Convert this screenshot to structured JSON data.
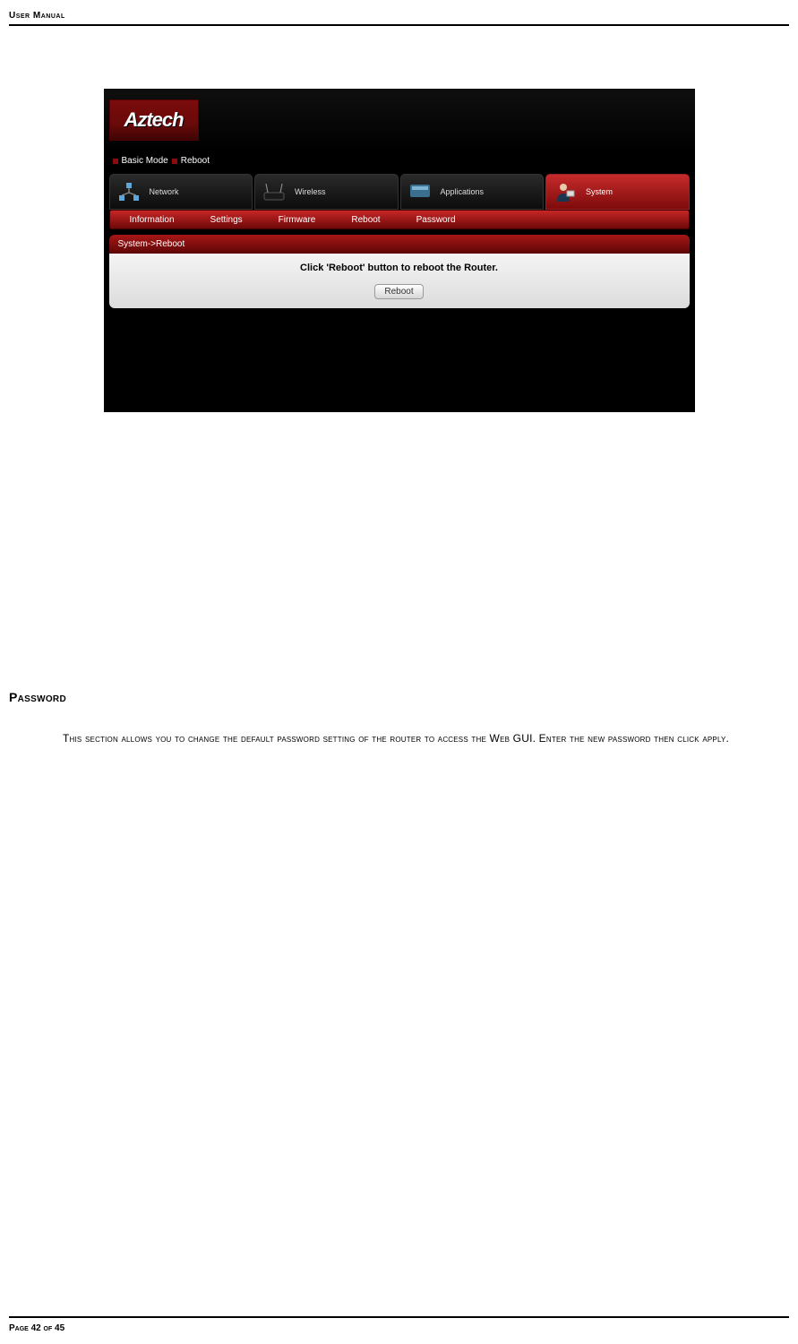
{
  "doc": {
    "header": "User Manual",
    "footer": "Page 42 of 45"
  },
  "screenshot": {
    "logo": "Aztech",
    "breadcrumb": {
      "part1": "Basic Mode",
      "part2": "Reboot"
    },
    "tabs": [
      "Network",
      "Wireless",
      "Applications",
      "System"
    ],
    "menu": [
      "Information",
      "Settings",
      "Firmware",
      "Reboot",
      "Password"
    ],
    "panel": {
      "header": "System->Reboot",
      "message": "Click 'Reboot' button to reboot the Router.",
      "button": "Reboot"
    }
  },
  "section": {
    "heading": "Password",
    "body": "This section allows you to change the default password setting of the router to access the Web GUI. Enter the new password then click apply."
  }
}
